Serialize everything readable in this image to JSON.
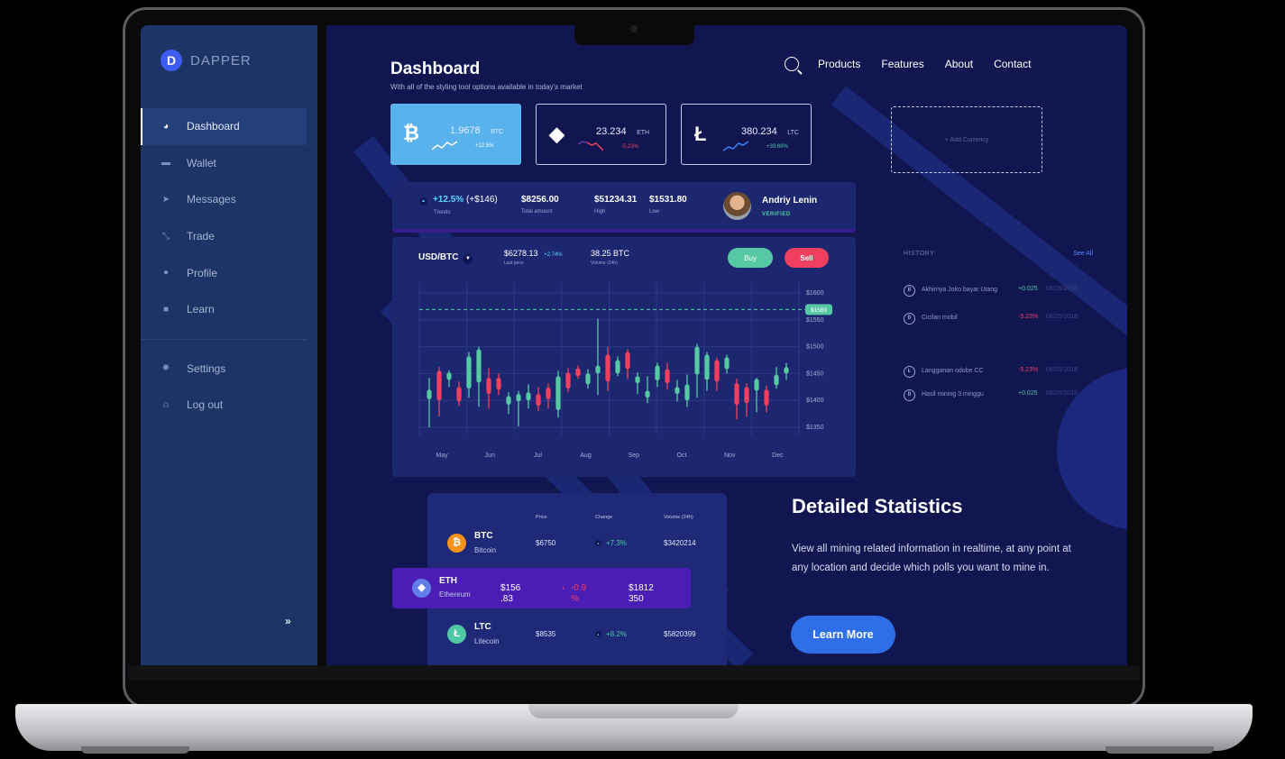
{
  "brand": {
    "name": "DAPPER",
    "mark": "D"
  },
  "sidebar": {
    "items": [
      {
        "label": "Dashboard",
        "icon": "pie-chart-icon",
        "active": true
      },
      {
        "label": "Wallet",
        "icon": "wallet-icon"
      },
      {
        "label": "Messages",
        "icon": "send-icon"
      },
      {
        "label": "Trade",
        "icon": "trade-icon"
      },
      {
        "label": "Profile",
        "icon": "user-icon"
      },
      {
        "label": "Learn",
        "icon": "book-icon"
      }
    ],
    "bottom_items": [
      {
        "label": "Settings",
        "icon": "gear-icon"
      },
      {
        "label": "Log out",
        "icon": "logout-icon"
      }
    ],
    "collapse_label": "»"
  },
  "header": {
    "title": "Dashboard",
    "subtitle": "With all of the styling tool options available in today's market",
    "nav": [
      "Products",
      "Features",
      "About",
      "Contact"
    ]
  },
  "currencies": [
    {
      "symbol": "₿",
      "value": "1.9678",
      "ticker": "BTC",
      "change": "+12.5%",
      "trend": "up",
      "active": true
    },
    {
      "symbol": "◆",
      "value": "23.234",
      "ticker": "ETH",
      "change": "-5.23%",
      "trend": "down"
    },
    {
      "symbol": "Ł",
      "value": "380.234",
      "ticker": "LTC",
      "change": "+39.69%",
      "trend": "up"
    }
  ],
  "add_currency_label": "+ Add Currency",
  "stats": {
    "trend_value": "+12.5%",
    "trend_abs": "(+$146)",
    "trend_label": "Trends",
    "total_value": "$8256.00",
    "total_label": "Total amount",
    "high_value": "$51234.31",
    "high_label": "High",
    "low_value": "$1531.80",
    "low_label": "Low"
  },
  "user": {
    "name": "Andriy Lenin",
    "status": "VERIFIED"
  },
  "trade": {
    "pair": "USD/BTC",
    "last_price": "$6278.13",
    "last_price_change": "+2.74%",
    "last_price_label": "Last price",
    "volume": "38.25 BTC",
    "volume_label": "Volume (24h)",
    "buy_label": "Buy",
    "sell_label": "Sell"
  },
  "chart_data": {
    "type": "candlestick",
    "x_ticks": [
      "May",
      "Jun",
      "Jul",
      "Aug",
      "Sep",
      "Oct",
      "Nov",
      "Dec"
    ],
    "y_ticks": [
      "$1600",
      "$1550",
      "$1500",
      "$1450",
      "$1400",
      "$1350"
    ],
    "y_range": [
      1335,
      1620
    ],
    "current_price": "$1569",
    "current_value": 1569,
    "grid": true,
    "up_color": "#56c9a4",
    "down_color": "#f1405f",
    "candles": [
      {
        "o": 1402,
        "c": 1420,
        "h": 1442,
        "l": 1350
      },
      {
        "o": 1455,
        "c": 1400,
        "h": 1462,
        "l": 1370
      },
      {
        "o": 1438,
        "c": 1452,
        "h": 1456,
        "l": 1425
      },
      {
        "o": 1425,
        "c": 1398,
        "h": 1435,
        "l": 1390
      },
      {
        "o": 1422,
        "c": 1482,
        "h": 1490,
        "l": 1405
      },
      {
        "o": 1433,
        "c": 1495,
        "h": 1500,
        "l": 1388
      },
      {
        "o": 1442,
        "c": 1412,
        "h": 1460,
        "l": 1385
      },
      {
        "o": 1442,
        "c": 1420,
        "h": 1450,
        "l": 1410
      },
      {
        "o": 1392,
        "c": 1408,
        "h": 1415,
        "l": 1375
      },
      {
        "o": 1398,
        "c": 1412,
        "h": 1418,
        "l": 1352
      },
      {
        "o": 1400,
        "c": 1415,
        "h": 1430,
        "l": 1385
      },
      {
        "o": 1412,
        "c": 1390,
        "h": 1425,
        "l": 1380
      },
      {
        "o": 1424,
        "c": 1402,
        "h": 1432,
        "l": 1385
      },
      {
        "o": 1382,
        "c": 1445,
        "h": 1455,
        "l": 1368
      },
      {
        "o": 1452,
        "c": 1422,
        "h": 1460,
        "l": 1415
      },
      {
        "o": 1460,
        "c": 1445,
        "h": 1465,
        "l": 1440
      },
      {
        "o": 1430,
        "c": 1450,
        "h": 1458,
        "l": 1422
      },
      {
        "o": 1450,
        "c": 1465,
        "h": 1552,
        "l": 1410
      },
      {
        "o": 1485,
        "c": 1435,
        "h": 1500,
        "l": 1418
      },
      {
        "o": 1450,
        "c": 1475,
        "h": 1482,
        "l": 1445
      },
      {
        "o": 1490,
        "c": 1458,
        "h": 1495,
        "l": 1440
      },
      {
        "o": 1432,
        "c": 1445,
        "h": 1452,
        "l": 1412
      },
      {
        "o": 1405,
        "c": 1418,
        "h": 1445,
        "l": 1395
      },
      {
        "o": 1437,
        "c": 1465,
        "h": 1470,
        "l": 1425
      },
      {
        "o": 1458,
        "c": 1432,
        "h": 1470,
        "l": 1420
      },
      {
        "o": 1412,
        "c": 1425,
        "h": 1438,
        "l": 1398
      },
      {
        "o": 1400,
        "c": 1430,
        "h": 1448,
        "l": 1388
      },
      {
        "o": 1448,
        "c": 1500,
        "h": 1505,
        "l": 1405
      },
      {
        "o": 1438,
        "c": 1485,
        "h": 1490,
        "l": 1418
      },
      {
        "o": 1475,
        "c": 1435,
        "h": 1480,
        "l": 1418
      },
      {
        "o": 1458,
        "c": 1480,
        "h": 1485,
        "l": 1450
      },
      {
        "o": 1432,
        "c": 1392,
        "h": 1440,
        "l": 1365
      },
      {
        "o": 1425,
        "c": 1395,
        "h": 1432,
        "l": 1370
      },
      {
        "o": 1418,
        "c": 1440,
        "h": 1442,
        "l": 1378
      },
      {
        "o": 1420,
        "c": 1390,
        "h": 1428,
        "l": 1378
      },
      {
        "o": 1428,
        "c": 1448,
        "h": 1462,
        "l": 1422
      },
      {
        "o": 1450,
        "c": 1462,
        "h": 1470,
        "l": 1438
      }
    ]
  },
  "history": {
    "title": "HISTORY",
    "see_all": "See All",
    "items": [
      {
        "icon": "B",
        "name": "Akhirnya Joko bayar Utang",
        "amount": "+0.025",
        "amount_color": "#4fc9a5",
        "date": "08/26/2018"
      },
      {
        "icon": "B",
        "name": "Cicilan mobil",
        "amount": "-5.23%",
        "amount_color": "#f1405f",
        "date": "08/26/2018"
      },
      {
        "icon": "Ł",
        "name": "Langganan odobe CC",
        "amount": "-5.23%",
        "amount_color": "#f1405f",
        "date": "08/26/2018"
      },
      {
        "icon": "B",
        "name": "Hasil mining 3 minggu",
        "amount": "+0.025",
        "amount_color": "#4fc9a5",
        "date": "08/26/2018"
      }
    ]
  },
  "market_table": {
    "headers": [
      "Price",
      "Change",
      "Volume (24h)"
    ],
    "rows": [
      {
        "ticker": "BTC",
        "name": "Bitcoin",
        "price": "$6750",
        "change": "+7.3%",
        "trend": "up",
        "volume": "$3420214",
        "icon_color": "#f7931a",
        "icon": "₿"
      },
      {
        "ticker": "ETH",
        "name": "Ethereum",
        "price_line1": "$156",
        "price_line2": ".83",
        "change_line1": "-0.9",
        "change_line2": "%",
        "trend": "down",
        "volume_line1": "$1812",
        "volume_line2": "350",
        "icon_color": "#627eea",
        "icon": "◆",
        "highlighted": true
      },
      {
        "ticker": "LTC",
        "name": "Litecoin",
        "price": "$8535",
        "change": "+8.2%",
        "trend": "up",
        "volume": "$5820399",
        "icon_color": "#4fc9a5",
        "icon": "Ł"
      }
    ]
  },
  "promo": {
    "title": "Detailed Statistics",
    "text": "View all mining related information in realtime, at any point at any location and decide which polls you want to mine in.",
    "button": "Learn More"
  }
}
